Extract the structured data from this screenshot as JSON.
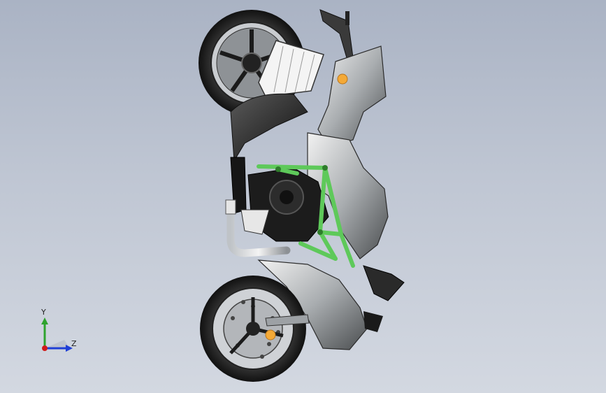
{
  "viewport": {
    "background_top": "#aab3c4",
    "background_bottom": "#d3d8e1"
  },
  "model": {
    "name_icon": "motorcycle-model-icon",
    "frame_color": "#5ec95a",
    "body_color": "#b9bcbe",
    "marker_color": "#f4a936"
  },
  "triad": {
    "y_label": "Y",
    "z_label": "Z",
    "y_color": "#2ea32e",
    "z_color": "#1f3fd6",
    "x_color": "#d01a1a"
  }
}
